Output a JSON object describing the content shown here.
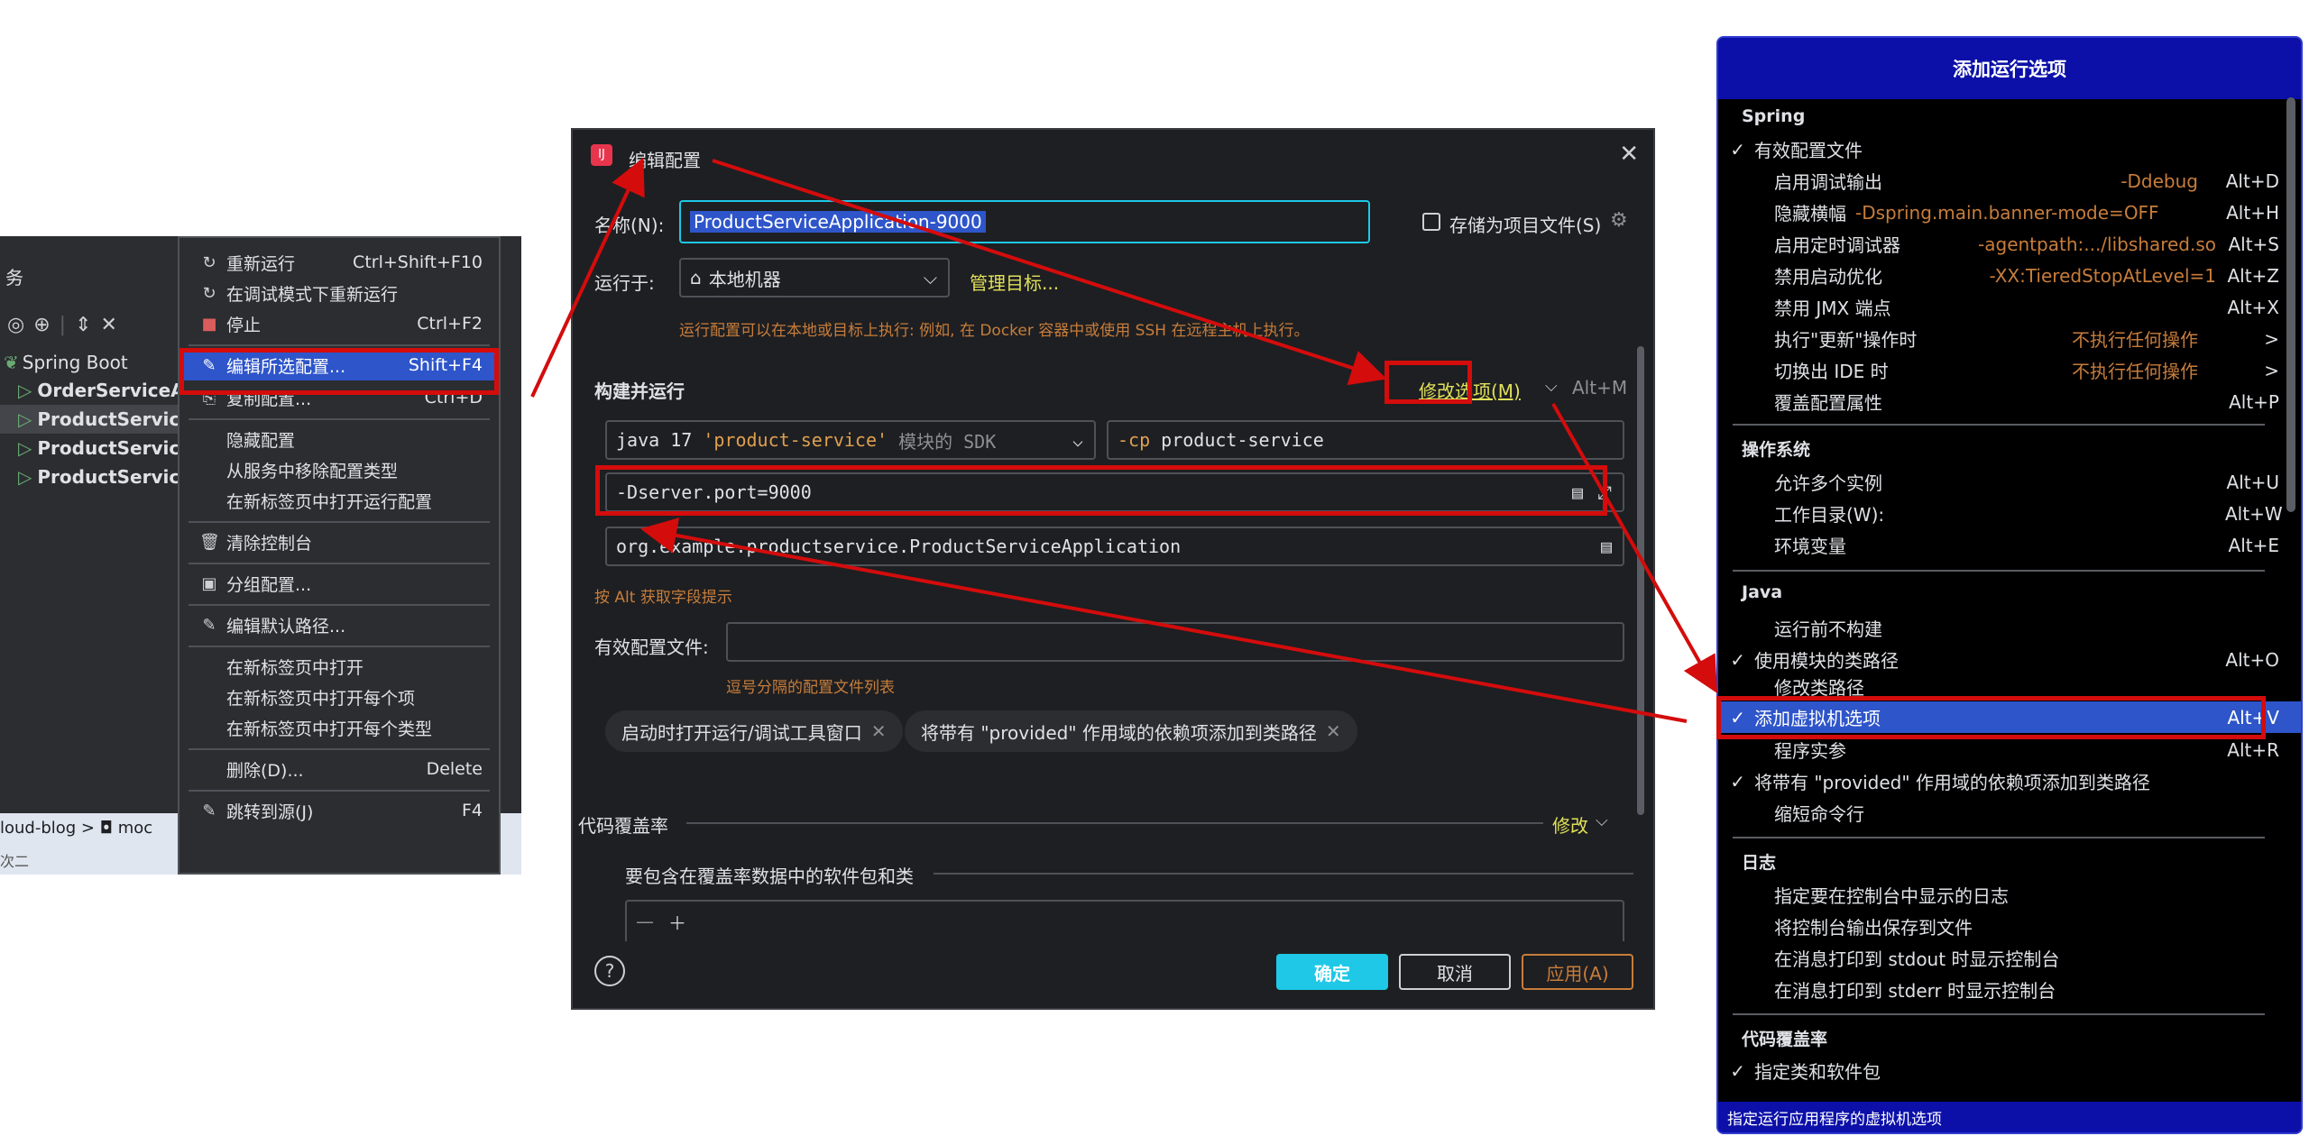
{
  "left": {
    "header": "务",
    "toolbar_icons": [
      "eye-icon",
      "add-tab-icon",
      "expand-collapse-icon",
      "close-icon"
    ],
    "tree": [
      {
        "label": "Spring Boot",
        "bold": false
      },
      {
        "label": "OrderServiceAp",
        "bold": true
      },
      {
        "label": "ProductService",
        "bold": true
      },
      {
        "label": "ProductService",
        "bold": true
      },
      {
        "label": "ProductService",
        "bold": true
      }
    ],
    "breadcrumb": "loud-blog  >  ◘ moc",
    "bottom_text": "次二"
  },
  "context_menu": {
    "items": [
      {
        "icon": "↻",
        "label": "重新运行",
        "shortcut": "Ctrl+Shift+F10"
      },
      {
        "icon": "↻",
        "label": "在调试模式下重新运行",
        "shortcut": ""
      },
      {
        "icon": "■",
        "label": "停止",
        "shortcut": "Ctrl+F2"
      },
      {
        "icon": "✎",
        "label": "编辑所选配置...",
        "shortcut": "Shift+F4"
      },
      {
        "icon": "⎘",
        "label": "复制配置...",
        "shortcut": "Ctrl+D"
      },
      {
        "icon": "",
        "label": "隐藏配置",
        "shortcut": ""
      },
      {
        "icon": "",
        "label": "从服务中移除配置类型",
        "shortcut": ""
      },
      {
        "icon": "",
        "label": "在新标签页中打开运行配置",
        "shortcut": ""
      },
      {
        "icon": "🗑",
        "label": "清除控制台",
        "shortcut": ""
      },
      {
        "icon": "▣",
        "label": "分组配置...",
        "shortcut": ""
      },
      {
        "icon": "✎",
        "label": "编辑默认路径...",
        "shortcut": ""
      },
      {
        "icon": "",
        "label": "在新标签页中打开",
        "shortcut": ""
      },
      {
        "icon": "",
        "label": "在新标签页中打开每个项",
        "shortcut": ""
      },
      {
        "icon": "",
        "label": "在新标签页中打开每个类型",
        "shortcut": ""
      },
      {
        "icon": "",
        "label": "删除(D)...",
        "shortcut": "Delete"
      },
      {
        "icon": "✎",
        "label": "跳转到源(J)",
        "shortcut": "F4"
      }
    ]
  },
  "dialog": {
    "title": "编辑配置",
    "name_label": "名称(N):",
    "name_value": "ProductServiceApplication-9000",
    "store_label": "存储为项目文件(S)",
    "run_on_label": "运行于:",
    "run_on_value": "本地机器",
    "manage_targets": "管理目标...",
    "run_hint": "运行配置可以在本地或目标上执行: 例如, 在 Docker 容器中或使用 SSH 在远程主机上执行。",
    "section_build": "构建并运行",
    "modify_options": "修改选项(M)",
    "modify_shortcut": "Alt+M",
    "sdk_text": "java 17",
    "sdk_module": "'product-service'",
    "sdk_suffix": "模块的 SDK",
    "cp_flag": "-cp",
    "cp_value": "product-service",
    "vm_options": "-Dserver.port=9000",
    "main_class": "org.example.productservice.ProductServiceApplication",
    "alt_hint": "按 Alt 获取字段提示",
    "profiles_label": "有效配置文件:",
    "profiles_hint": "逗号分隔的配置文件列表",
    "chip1": "启动时打开运行/调试工具窗口",
    "chip2": "将带有 \"provided\" 作用域的依赖项添加到类路径",
    "coverage_label": "代码覆盖率",
    "coverage_modify": "修改",
    "coverage_include": "要包含在覆盖率数据中的软件包和类",
    "ok": "确定",
    "cancel": "取消",
    "apply": "应用(A)"
  },
  "popup": {
    "title": "添加运行选项",
    "footer": "指定运行应用程序的虚拟机选项",
    "sections": {
      "spring": "Spring",
      "os": "操作系统",
      "java": "Java",
      "log": "日志",
      "coverage": "代码覆盖率"
    },
    "items": [
      {
        "check": "✓",
        "label": "有效配置文件",
        "hint": "",
        "shortcut": ""
      },
      {
        "check": "",
        "label": "启用调试输出",
        "hint": "-Ddebug",
        "shortcut": "Alt+D"
      },
      {
        "check": "",
        "label": "隐藏横幅",
        "hint": "-Dspring.main.banner-mode=OFF",
        "shortcut": "Alt+H"
      },
      {
        "check": "",
        "label": "启用定时调试器",
        "hint": "-agentpath:.../libshared.so",
        "shortcut": "Alt+S"
      },
      {
        "check": "",
        "label": "禁用启动优化",
        "hint": "-XX:TieredStopAtLevel=1",
        "shortcut": "Alt+Z"
      },
      {
        "check": "",
        "label": "禁用 JMX 端点",
        "hint": "",
        "shortcut": "Alt+X"
      },
      {
        "check": "",
        "label": "执行\"更新\"操作时",
        "hint": "不执行任何操作",
        "shortcut": ">"
      },
      {
        "check": "",
        "label": "切换出 IDE 时",
        "hint": "不执行任何操作",
        "shortcut": ">"
      },
      {
        "check": "",
        "label": "覆盖配置属性",
        "hint": "",
        "shortcut": "Alt+P"
      },
      {
        "check": "",
        "label": "允许多个实例",
        "hint": "",
        "shortcut": "Alt+U"
      },
      {
        "check": "",
        "label": "工作目录(W):",
        "hint": "",
        "shortcut": "Alt+W"
      },
      {
        "check": "",
        "label": "环境变量",
        "hint": "",
        "shortcut": "Alt+E"
      },
      {
        "check": "",
        "label": "运行前不构建",
        "hint": "",
        "shortcut": ""
      },
      {
        "check": "✓",
        "label": "使用模块的类路径",
        "hint": "",
        "shortcut": "Alt+O"
      },
      {
        "check": "",
        "label": "修改类路径",
        "hint": "",
        "shortcut": ""
      },
      {
        "check": "✓",
        "label": "添加虚拟机选项",
        "hint": "",
        "shortcut": "Alt+V"
      },
      {
        "check": "",
        "label": "程序实参",
        "hint": "",
        "shortcut": "Alt+R"
      },
      {
        "check": "✓",
        "label": "将带有 \"provided\" 作用域的依赖项添加到类路径",
        "hint": "",
        "shortcut": ""
      },
      {
        "check": "",
        "label": "缩短命令行",
        "hint": "",
        "shortcut": ""
      },
      {
        "check": "",
        "label": "指定要在控制台中显示的日志",
        "hint": "",
        "shortcut": ""
      },
      {
        "check": "",
        "label": "将控制台输出保存到文件",
        "hint": "",
        "shortcut": ""
      },
      {
        "check": "",
        "label": "在消息打印到 stdout 时显示控制台",
        "hint": "",
        "shortcut": ""
      },
      {
        "check": "",
        "label": "在消息打印到 stderr 时显示控制台",
        "hint": "",
        "shortcut": ""
      },
      {
        "check": "✓",
        "label": "指定类和软件包",
        "hint": "",
        "shortcut": ""
      }
    ]
  },
  "colors": {
    "highlight": "#2e55c9",
    "popup_header": "#0c10a8",
    "annotation_red": "#d40c0c",
    "accent_cyan": "#1ec8e6"
  }
}
